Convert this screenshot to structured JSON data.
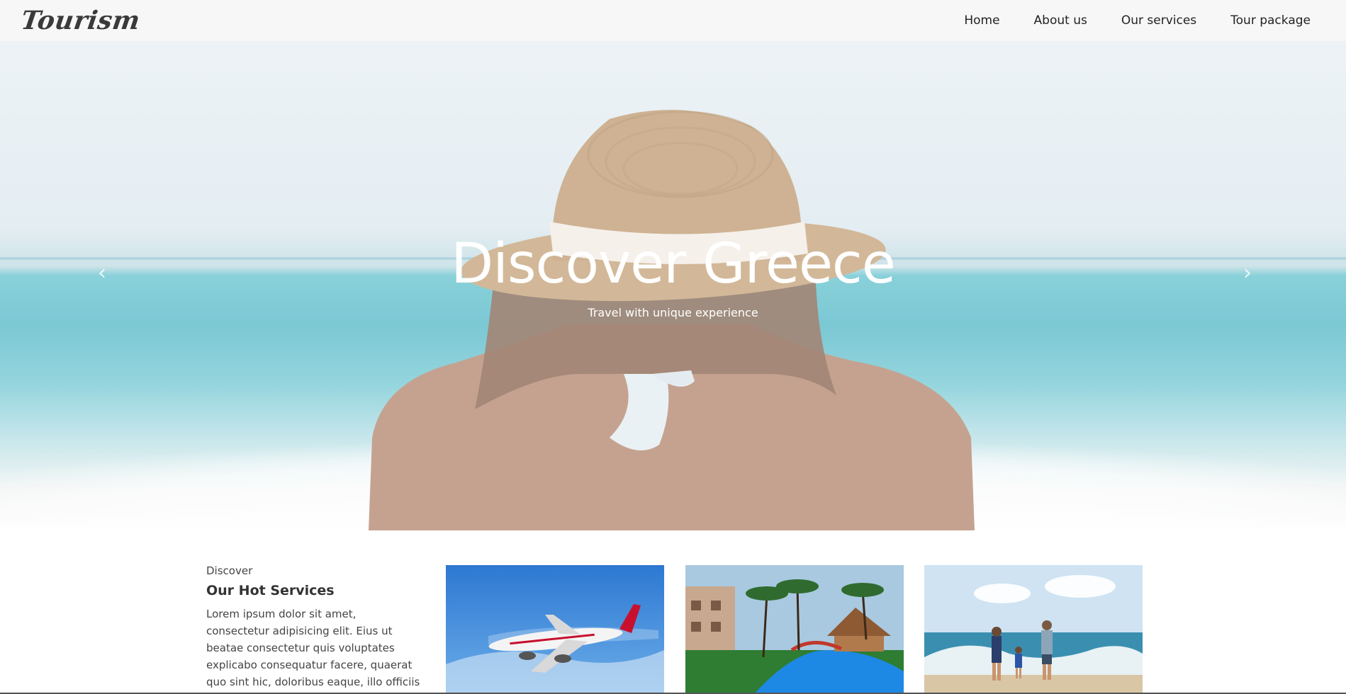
{
  "brand": {
    "logo_text": "Tourism"
  },
  "nav": {
    "items": [
      {
        "label": "Home"
      },
      {
        "label": "About us"
      },
      {
        "label": "Our services"
      },
      {
        "label": "Tour package"
      }
    ]
  },
  "hero": {
    "title": "Discover Greece",
    "subtitle": "Travel with unique experience",
    "prev_icon": "chevron-left-icon",
    "next_icon": "chevron-right-icon"
  },
  "services": {
    "eyebrow": "Discover",
    "heading": "Our Hot Services",
    "body": "Lorem ipsum dolor sit amet, consectetur adipisicing elit. Eius ut beatae consectetur quis voluptates explicabo consequatur facere, quaerat quo sint hic, doloribus eaque, illo officiis dolorum",
    "cards": [
      {
        "image": "airplane-in-sky"
      },
      {
        "image": "resort-pool-with-palms"
      },
      {
        "image": "family-on-beach"
      }
    ]
  },
  "colors": {
    "navbar_bg": "#f7f7f8",
    "sea": "#5fbccb",
    "hat": "#c9a982",
    "skin": "#b98e78"
  }
}
